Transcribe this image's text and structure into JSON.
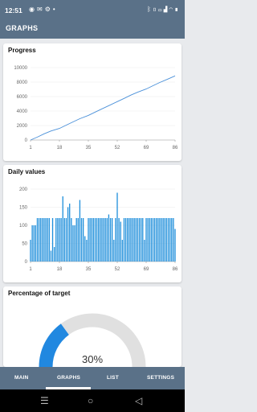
{
  "status_bar": {
    "time": "12:51",
    "left_icons": [
      "messenger-icon",
      "gmail-icon",
      "settings-icon",
      "dot-icon"
    ],
    "battery": "",
    "right_icons": [
      "bluetooth-icon",
      "vibrate-icon",
      "volte-icon",
      "signal-icon",
      "wifi-icon",
      "battery-icon"
    ]
  },
  "app_bar": {
    "title": "GRAPHS"
  },
  "cards": {
    "progress": {
      "title": "Progress",
      "chart_data": {
        "type": "line",
        "title": "Progress",
        "x": [
          1,
          5,
          9,
          13,
          18,
          22,
          26,
          30,
          35,
          39,
          43,
          47,
          52,
          56,
          60,
          64,
          69,
          73,
          77,
          81,
          86
        ],
        "y": [
          0,
          400,
          850,
          1250,
          1600,
          2050,
          2500,
          2950,
          3400,
          3850,
          4300,
          4750,
          5300,
          5750,
          6200,
          6600,
          7050,
          7500,
          7950,
          8350,
          8850
        ],
        "xticks": [
          "1",
          "18",
          "35",
          "52",
          "69",
          "86"
        ],
        "yticks": [
          "0",
          "2000",
          "4000",
          "6000",
          "8000",
          "10000"
        ],
        "xlim": [
          1,
          86
        ],
        "ylim": [
          0,
          10000
        ],
        "color": "#4a90d9",
        "grid": true
      }
    },
    "daily": {
      "title": "Daily values",
      "chart_data": {
        "type": "bar",
        "title": "Daily values",
        "categories_range": [
          1,
          86
        ],
        "values": [
          60,
          100,
          100,
          100,
          120,
          120,
          120,
          120,
          120,
          120,
          120,
          120,
          30,
          120,
          40,
          120,
          120,
          120,
          120,
          180,
          120,
          120,
          150,
          160,
          120,
          100,
          100,
          120,
          120,
          170,
          120,
          120,
          70,
          60,
          120,
          120,
          120,
          120,
          120,
          120,
          120,
          120,
          120,
          120,
          120,
          120,
          130,
          120,
          120,
          60,
          120,
          190,
          120,
          110,
          60,
          120,
          120,
          120,
          120,
          120,
          120,
          120,
          120,
          120,
          120,
          120,
          120,
          60,
          120,
          120,
          120,
          120,
          120,
          120,
          120,
          120,
          120,
          120,
          120,
          120,
          120,
          120,
          120,
          120,
          120,
          90
        ],
        "xticks": [
          "1",
          "18",
          "35",
          "52",
          "69",
          "86"
        ],
        "yticks": [
          "0",
          "50",
          "100",
          "150",
          "200"
        ],
        "ylim": [
          0,
          200
        ],
        "color": "#1f8fdb",
        "grid": true
      }
    },
    "target": {
      "title": "Percentage of target",
      "percent_label": "30%",
      "chart_data": {
        "type": "pie",
        "title": "Percentage of target",
        "values": [
          30,
          70
        ],
        "labels": [
          "",
          ""
        ],
        "colors": [
          "#2188e0",
          "#e0e0e0"
        ]
      }
    }
  },
  "bottom_nav": {
    "tabs": [
      {
        "label": "MAIN"
      },
      {
        "label": "GRAPHS"
      },
      {
        "label": "LIST"
      },
      {
        "label": "SETTINGS"
      }
    ],
    "active": "GRAPHS"
  },
  "system_nav": {
    "icons": [
      "menu-icon",
      "home-icon",
      "back-icon"
    ]
  }
}
